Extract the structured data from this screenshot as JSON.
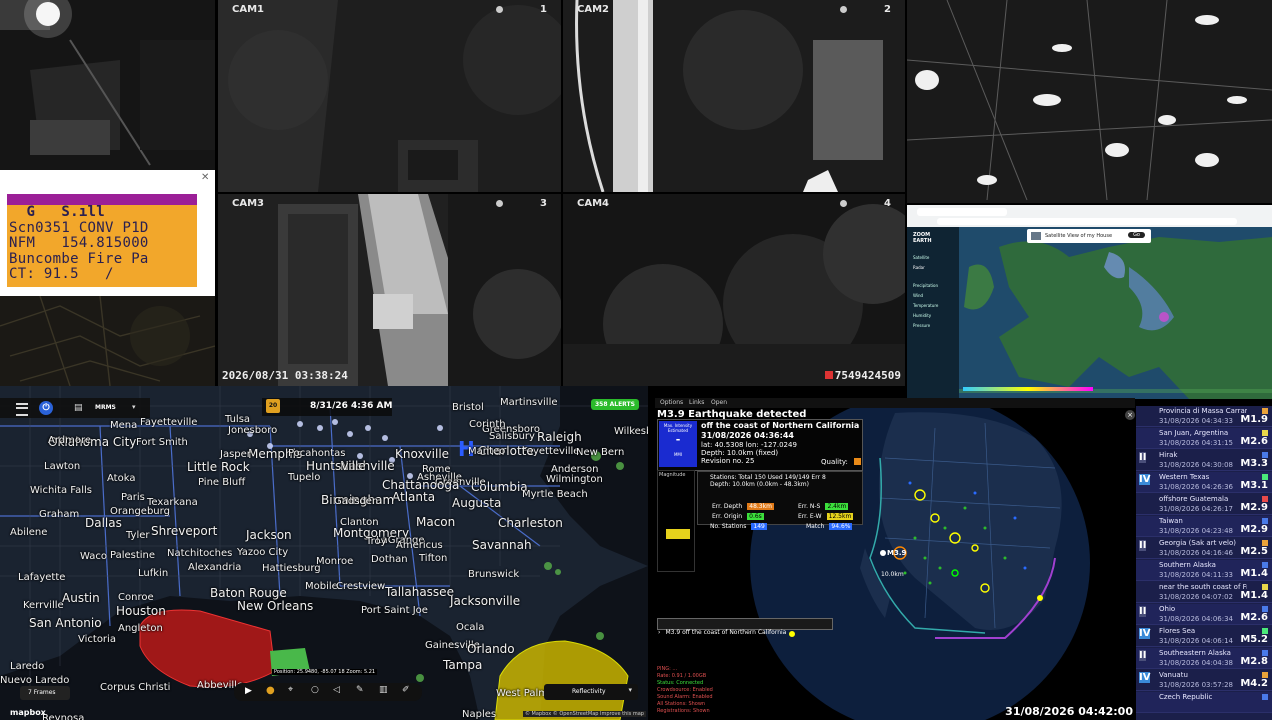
{
  "cameras": {
    "cam1": {
      "label": "CAM1",
      "num": "1"
    },
    "cam2": {
      "label": "CAM2",
      "num": "2"
    },
    "cam3": {
      "label": "CAM3",
      "num": "3"
    },
    "cam4": {
      "label": "CAM4",
      "num": "4"
    },
    "timestamp": "2026/08/31 03:38:24",
    "device_id": "7549424509"
  },
  "scanner": {
    "line1": "  G   S.ıll",
    "line2": "Scn0351 CONV P1D",
    "line3": "NFM   154.815000",
    "line4": "Buncombe Fire Pa",
    "line5": "CT: 91.5   /"
  },
  "weather_app": {
    "brand": "ZOOM EARTH",
    "popup": "Satellite View of my House",
    "popup_btn": "Go",
    "menu": [
      "Satellite",
      "Radar",
      "Precipitation",
      "Wind",
      "Temperature",
      "Humidity",
      "Pressure"
    ]
  },
  "radar": {
    "product": "MRMS",
    "datetime": "8/31/26 4:36 AM",
    "alerts_badge": "358 ALERTS",
    "frames": "7 Frames",
    "product_select": "Reflectivity",
    "position": "Position: 25.9480, -85.07 18  Zoom: 5.21",
    "attribution_left": "mapbox",
    "attribution_right": "© Mapbox © OpenStreetMap Improve this map",
    "cities": [
      "Oklahoma City",
      "Fort Smith",
      "Memphis",
      "Jonesboro",
      "Nashville",
      "Knoxville",
      "Bristol",
      "Martinsville",
      "Raleigh",
      "Fayetteville",
      "Fayetteville",
      "Charlotte",
      "Columbia",
      "Atlanta",
      "Birmingham",
      "Montgomery",
      "Jackson",
      "Little Rock",
      "Tupelo",
      "Huntsville",
      "Augusta",
      "Charleston",
      "Macon",
      "Savannah",
      "Shreveport",
      "Texarkana",
      "Dallas",
      "Waco",
      "Tyler",
      "Austin",
      "San Antonio",
      "Houston",
      "Baton Rouge",
      "New Orleans",
      "Mobile",
      "Tallahassee",
      "Jacksonville",
      "Gainesville",
      "Orlando",
      "Tampa",
      "Ocala",
      "West Palm Beach",
      "Naples",
      "Victoria",
      "Corpus Christi",
      "Laredo",
      "Nuevo Laredo",
      "Lawton",
      "Wichita Falls",
      "Abilene",
      "Wilmington",
      "Myrtle Beach",
      "New Bern",
      "Greensboro",
      "Salisbury",
      "Asheville",
      "Gadsden",
      "Dothan",
      "Brunswick",
      "Lafayette",
      "Hattiesburg",
      "Monroe",
      "Pine Bluff",
      "Greenville",
      "Paris",
      "Lufkin",
      "Alexandria",
      "Natchitoches",
      "Palestine",
      "Kerrville",
      "Conroe",
      "Angleton",
      "Port Saint Joe",
      "Crestview",
      "Abbeville",
      "Yazoo City",
      "LaGrange",
      "Americus",
      "Troy",
      "Tifton",
      "Clanton",
      "Reynosa",
      "Graham",
      "Atoka",
      "Jasper",
      "Mena",
      "Tulsa",
      "Pocahontas",
      "Corinth",
      "Wilkesboro",
      "Manteo",
      "Chattanooga",
      "Rome",
      "Anderson",
      "Orangeburg",
      "Ardmore"
    ]
  },
  "quake": {
    "menu": [
      "Options",
      "Links",
      "Open"
    ],
    "title": "M3.9 Earthquake detected",
    "location": "off the coast of Northern California",
    "datetime": "31/08/2026 04:36:44",
    "latlon": "lat: 40.5308  lon: -127.0249",
    "depth": "Depth: 10.0km (fixed)",
    "revision": "Revision no. 25",
    "intensity_label": "Max. Intensity Estimated",
    "intensity_val": "-",
    "intensity_unit": "MMI",
    "quality_label": "Quality:",
    "magnitude_label": "Magnitude",
    "stations": "Stations: Total 150  Used 149/149  Err 8",
    "depth2": "Depth: 10.0km (0.0km - 48.3km)",
    "err_depth": "Err. Depth",
    "err_depth_val": "48.3km",
    "err_ns": "Err. N-S",
    "err_ns_val": "2.4km",
    "err_origin": "Err. Origin",
    "err_origin_val": "0.6s",
    "err_ew": "Err. E-W",
    "err_ew_val": "12.5km",
    "no_stations": "No. Stations",
    "no_stations_val": "149",
    "match": "Match",
    "match_val": "94.6%",
    "ticker": "M3.9 off the coast of Northern California",
    "marker_mag": "M3.9",
    "marker_depth": "10.0km",
    "status_lines": [
      "PING: ...",
      "Rate: 0.91 / 1.00GB",
      "Status: Connected",
      "Crowdsource: Enabled",
      "Sound Alarm: Enabled",
      "All Stations: Shown",
      "Registrations: Shown"
    ],
    "clock": "31/08/2026 04:42:00"
  },
  "eq_list": [
    {
      "intensity": "",
      "loc": "Provincia di Massa Carrara,...",
      "time": "31/08/2026 04:34:33",
      "mag": "M1.9",
      "sq": "#e9a23a"
    },
    {
      "intensity": "",
      "loc": "San Juan, Argentina",
      "time": "31/08/2026 04:31:15",
      "mag": "M2.6",
      "sq": "#e9d84a"
    },
    {
      "intensity": "II",
      "loc": "Hirak",
      "time": "31/08/2026 04:30:08",
      "mag": "M3.3",
      "sq": "#4a7ae9"
    },
    {
      "intensity": "IV",
      "loc": "Western Texas",
      "time": "31/08/2026 04:26:36",
      "mag": "M3.1",
      "sq": "#4ae97a"
    },
    {
      "intensity": "",
      "loc": "offshore Guatemala",
      "time": "31/08/2026 04:26:17",
      "mag": "M2.9",
      "sq": "#e94a4a"
    },
    {
      "intensity": "",
      "loc": "Taiwan",
      "time": "31/08/2026 04:23:48",
      "mag": "M2.9",
      "sq": "#4a7ae9"
    },
    {
      "intensity": "II",
      "loc": "Georgia (Sak art velo)",
      "time": "31/08/2026 04:16:46",
      "mag": "M2.5",
      "sq": "#e9a23a"
    },
    {
      "intensity": "",
      "loc": "Southern Alaska",
      "time": "31/08/2026 04:11:33",
      "mag": "M1.4",
      "sq": "#4a7ae9"
    },
    {
      "intensity": "",
      "loc": "near the south coast of Fra...",
      "time": "31/08/2026 04:07:02",
      "mag": "M1.4",
      "sq": "#e9d84a"
    },
    {
      "intensity": "II",
      "loc": "Ohio",
      "time": "31/08/2026 04:06:34",
      "mag": "M2.6",
      "sq": "#4a7ae9"
    },
    {
      "intensity": "IV",
      "loc": "Flores Sea",
      "time": "31/08/2026 04:06:14",
      "mag": "M5.2",
      "sq": "#4ae97a"
    },
    {
      "intensity": "II",
      "loc": "Southeastern Alaska",
      "time": "31/08/2026 04:04:38",
      "mag": "M2.8",
      "sq": "#4a7ae9"
    },
    {
      "intensity": "IV",
      "loc": "Vanuatu",
      "time": "31/08/2026 03:57:28",
      "mag": "M4.2",
      "sq": "#e9a23a"
    },
    {
      "intensity": "",
      "loc": "Czech Republic",
      "time": "",
      "mag": "",
      "sq": "#4a7ae9"
    }
  ]
}
